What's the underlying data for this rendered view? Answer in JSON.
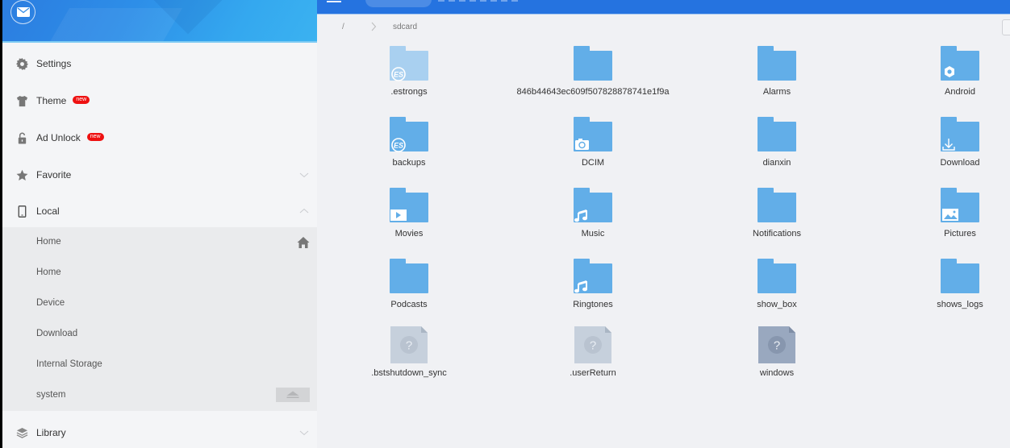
{
  "sidebar": {
    "header": {
      "mail_icon": "mail-icon"
    },
    "items": [
      {
        "id": "settings",
        "label": "Settings",
        "icon": "gear-icon"
      },
      {
        "id": "theme",
        "label": "Theme",
        "icon": "tshirt-icon",
        "badge": "new"
      },
      {
        "id": "ad-unlock",
        "label": "Ad Unlock",
        "icon": "unlock-icon",
        "badge": "new"
      },
      {
        "id": "favorite",
        "label": "Favorite",
        "icon": "star-icon",
        "chevron": "down"
      },
      {
        "id": "local",
        "label": "Local",
        "icon": "phone-icon",
        "chevron": "up"
      },
      {
        "id": "library",
        "label": "Library",
        "icon": "layers-icon",
        "chevron": "down"
      }
    ],
    "local_children": [
      {
        "label": "Home",
        "icon": "home-icon"
      },
      {
        "label": "Home"
      },
      {
        "label": "Device"
      },
      {
        "label": "Download"
      },
      {
        "label": "Internal Storage"
      },
      {
        "label": "system",
        "icon": "eject-icon"
      }
    ]
  },
  "toolbar": {
    "menu_icon": "hamburger-menu-icon",
    "active_tab": ""
  },
  "breadcrumb": {
    "root": "/",
    "current": "sdcard"
  },
  "files": [
    {
      "name": ".estrongs",
      "type": "folder",
      "overlay": "es-logo",
      "faded": true
    },
    {
      "name": "846b44643ec609f507828878741e1f9a",
      "type": "folder"
    },
    {
      "name": "Alarms",
      "type": "folder"
    },
    {
      "name": "Android",
      "type": "folder",
      "overlay": "gear"
    },
    {
      "name": "backups",
      "type": "folder",
      "overlay": "es-logo"
    },
    {
      "name": "DCIM",
      "type": "folder",
      "overlay": "camera"
    },
    {
      "name": "dianxin",
      "type": "folder"
    },
    {
      "name": "Download",
      "type": "folder",
      "overlay": "download"
    },
    {
      "name": "Movies",
      "type": "folder",
      "overlay": "play"
    },
    {
      "name": "Music",
      "type": "folder",
      "overlay": "music"
    },
    {
      "name": "Notifications",
      "type": "folder"
    },
    {
      "name": "Pictures",
      "type": "folder",
      "overlay": "picture"
    },
    {
      "name": "Podcasts",
      "type": "folder"
    },
    {
      "name": "Ringtones",
      "type": "folder",
      "overlay": "music"
    },
    {
      "name": "show_box",
      "type": "folder"
    },
    {
      "name": "shows_logs",
      "type": "folder"
    },
    {
      "name": ".bstshutdown_sync",
      "type": "unknown-file",
      "faded": true
    },
    {
      "name": ".userReturn",
      "type": "unknown-file",
      "faded": true
    },
    {
      "name": "windows",
      "type": "unknown-file"
    }
  ],
  "colors": {
    "accent": "#2573e0",
    "folder": "#62aee8",
    "folder_faded": "#a9d0f0",
    "badge": "#ee1111"
  }
}
